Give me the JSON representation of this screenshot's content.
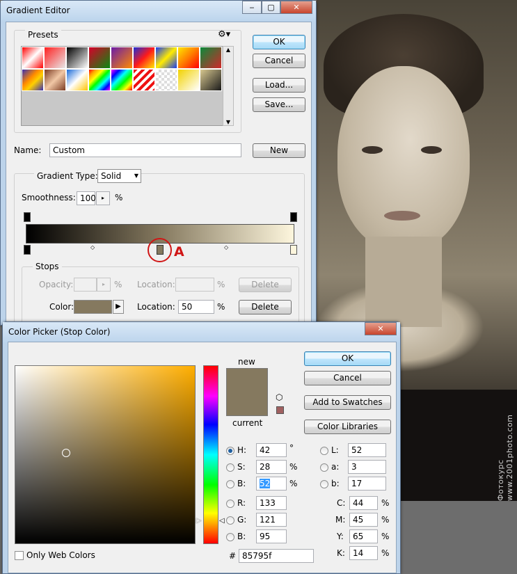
{
  "photo": {
    "watermark": "Фотокурс www.2001photo.com"
  },
  "annotation": {
    "label": "A",
    "color": "#d01515"
  },
  "gradient_editor": {
    "title": "Gradient Editor",
    "presets_label": "Presets",
    "gear_icon": "gear-icon",
    "buttons": {
      "ok": "OK",
      "cancel": "Cancel",
      "load": "Load...",
      "save": "Save...",
      "new": "New"
    },
    "name_label": "Name:",
    "name_value": "Custom",
    "gradient_type_label": "Gradient Type:",
    "gradient_type_value": "Solid",
    "smoothness_label": "Smoothness:",
    "smoothness_value": "100",
    "smoothness_unit": "%",
    "gradient": {
      "start_color": "#000000",
      "end_color": "#fdf6dd",
      "mid_stop_color": "#85795f"
    },
    "stops": {
      "legend": "Stops",
      "opacity_label": "Opacity:",
      "opacity_unit": "%",
      "location_label": "Location:",
      "location_unit": "%",
      "delete_label": "Delete",
      "color_label": "Color:",
      "color_value": "#85795f",
      "location_value": "50"
    }
  },
  "color_picker": {
    "title": "Color Picker (Stop Color)",
    "new_label": "new",
    "current_label": "current",
    "new_color": "#85795f",
    "current_color": "#85795f",
    "buttons": {
      "ok": "OK",
      "cancel": "Cancel",
      "add_to_swatches": "Add to Swatches",
      "color_libraries": "Color Libraries"
    },
    "hsb": [
      {
        "label": "H:",
        "value": "42",
        "unit": "°",
        "selected": true
      },
      {
        "label": "S:",
        "value": "28",
        "unit": "%",
        "selected": false
      },
      {
        "label": "B:",
        "value": "52",
        "unit": "%",
        "selected": false
      }
    ],
    "rgb": [
      {
        "label": "R:",
        "value": "133"
      },
      {
        "label": "G:",
        "value": "121"
      },
      {
        "label": "B:",
        "value": "95"
      }
    ],
    "lab": [
      {
        "label": "L:",
        "value": "52"
      },
      {
        "label": "a:",
        "value": "3"
      },
      {
        "label": "b:",
        "value": "17"
      }
    ],
    "cmyk": [
      {
        "label": "C:",
        "value": "44",
        "unit": "%"
      },
      {
        "label": "M:",
        "value": "45",
        "unit": "%"
      },
      {
        "label": "Y:",
        "value": "65",
        "unit": "%"
      },
      {
        "label": "K:",
        "value": "14",
        "unit": "%"
      }
    ],
    "hex_label": "#",
    "hex_value": "85795f",
    "only_web_colors": "Only Web Colors",
    "field_hue_color": "#ffae00"
  }
}
